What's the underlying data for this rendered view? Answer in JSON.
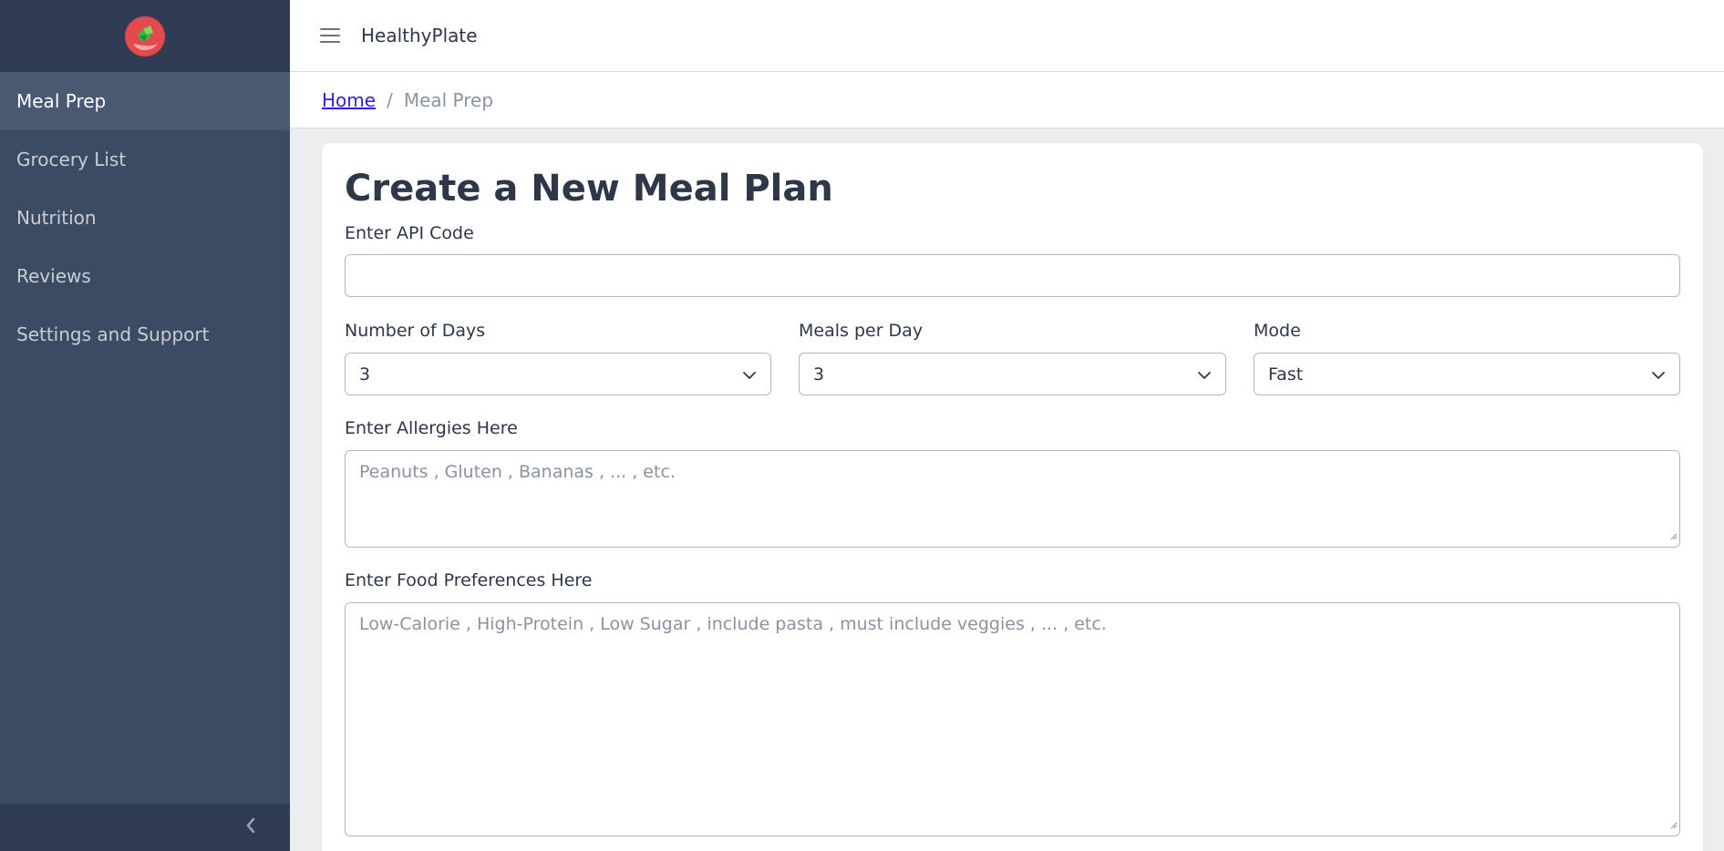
{
  "app": {
    "title": "HealthyPlate"
  },
  "sidebar": {
    "logo": "healthyplate-logo",
    "items": [
      {
        "label": "Meal Prep",
        "active": true
      },
      {
        "label": "Grocery List",
        "active": false
      },
      {
        "label": "Nutrition",
        "active": false
      },
      {
        "label": "Reviews",
        "active": false
      },
      {
        "label": "Settings and Support",
        "active": false
      }
    ],
    "toggler_icon": "chevron-left-icon"
  },
  "header": {
    "menu_icon": "hamburger-icon"
  },
  "breadcrumb": {
    "home": "Home",
    "separator": "/",
    "current": "Meal Prep"
  },
  "form": {
    "title": "Create a New Meal Plan",
    "api_code": {
      "label": "Enter API Code",
      "value": ""
    },
    "days": {
      "label": "Number of Days",
      "value": "3"
    },
    "meals": {
      "label": "Meals per Day",
      "value": "3"
    },
    "mode": {
      "label": "Mode",
      "value": "Fast"
    },
    "allergies": {
      "label": "Enter Allergies Here",
      "placeholder": "Peanuts , Gluten , Bananas , ... , etc."
    },
    "preferences": {
      "label": "Enter Food Preferences Here",
      "placeholder": "Low-Calorie , High-Protein , Low Sugar , include pasta , must include veggies , ... , etc."
    }
  },
  "colors": {
    "sidebar_bg": "#3c4b64",
    "sidebar_brand_bg": "#303c54",
    "active_item_bg": "#4a5872",
    "link": "#321fdb",
    "page_bg": "#ebedef"
  }
}
